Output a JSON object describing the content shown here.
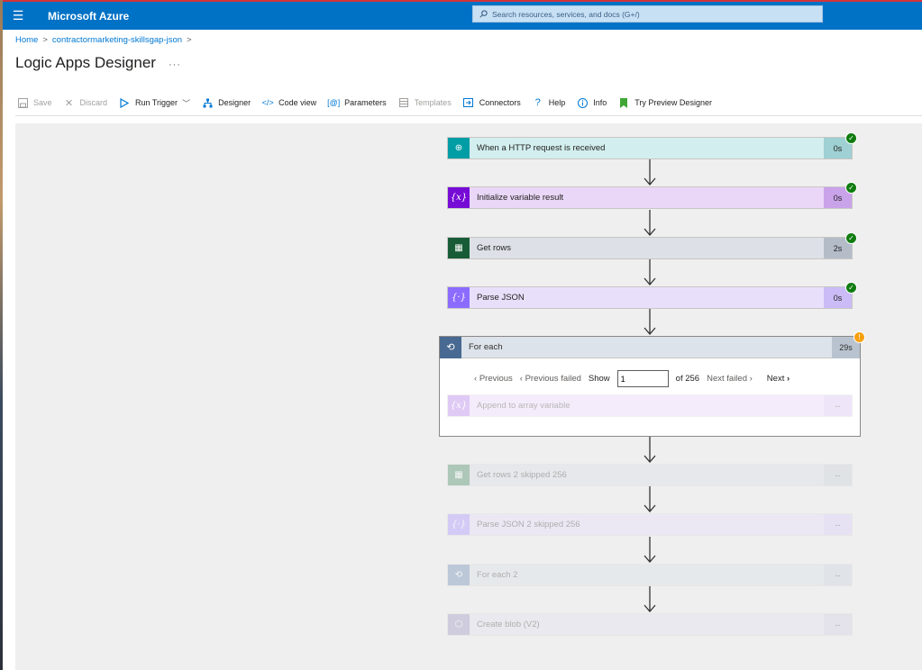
{
  "topbar": {
    "brand": "Microsoft Azure",
    "search_placeholder": "Search resources, services, and docs (G+/)"
  },
  "breadcrumb": {
    "home": "Home",
    "resource": "contractormarketing-skillsgap-json"
  },
  "page": {
    "title": "Logic Apps Designer",
    "more": "···"
  },
  "toolbar": {
    "save": "Save",
    "discard": "Discard",
    "run_trigger": "Run Trigger",
    "designer": "Designer",
    "code_view": "Code view",
    "parameters": "Parameters",
    "templates": "Templates",
    "connectors": "Connectors",
    "help": "Help",
    "info": "Info",
    "try_preview": "Try Preview Designer"
  },
  "steps": [
    {
      "label": "When a HTTP request is received",
      "duration": "0s",
      "status": "succeeded",
      "icon": "http-request-icon",
      "color": "#009da5"
    },
    {
      "label": "Initialize variable result",
      "duration": "0s",
      "status": "succeeded",
      "icon": "variable-icon",
      "color": "#770bd6"
    },
    {
      "label": "Get rows",
      "duration": "2s",
      "status": "succeeded",
      "icon": "excel-icon",
      "color": "#185c37"
    },
    {
      "label": "Parse JSON",
      "duration": "0s",
      "status": "succeeded",
      "icon": "parse-json-icon",
      "color": "#8c6cff"
    }
  ],
  "foreach": {
    "label": "For each",
    "duration": "29s",
    "status": "warning",
    "pager": {
      "previous": "Previous",
      "previous_failed": "Previous failed",
      "show": "Show",
      "current": "1",
      "of": "of 256",
      "next_failed": "Next failed",
      "next": "Next"
    },
    "inner": {
      "label": "Append to array variable",
      "duration": "--"
    }
  },
  "skipped_steps": [
    {
      "label": "Get rows 2 skipped 256",
      "duration": "--"
    },
    {
      "label": "Parse JSON 2 skipped 256",
      "duration": "--"
    },
    {
      "label": "For each 2",
      "duration": "--"
    },
    {
      "label": "Create blob (V2)",
      "duration": "--"
    }
  ],
  "colors": {
    "azure_blue": "#0072c6",
    "success": "#107c10",
    "warning": "#f7a00f"
  }
}
